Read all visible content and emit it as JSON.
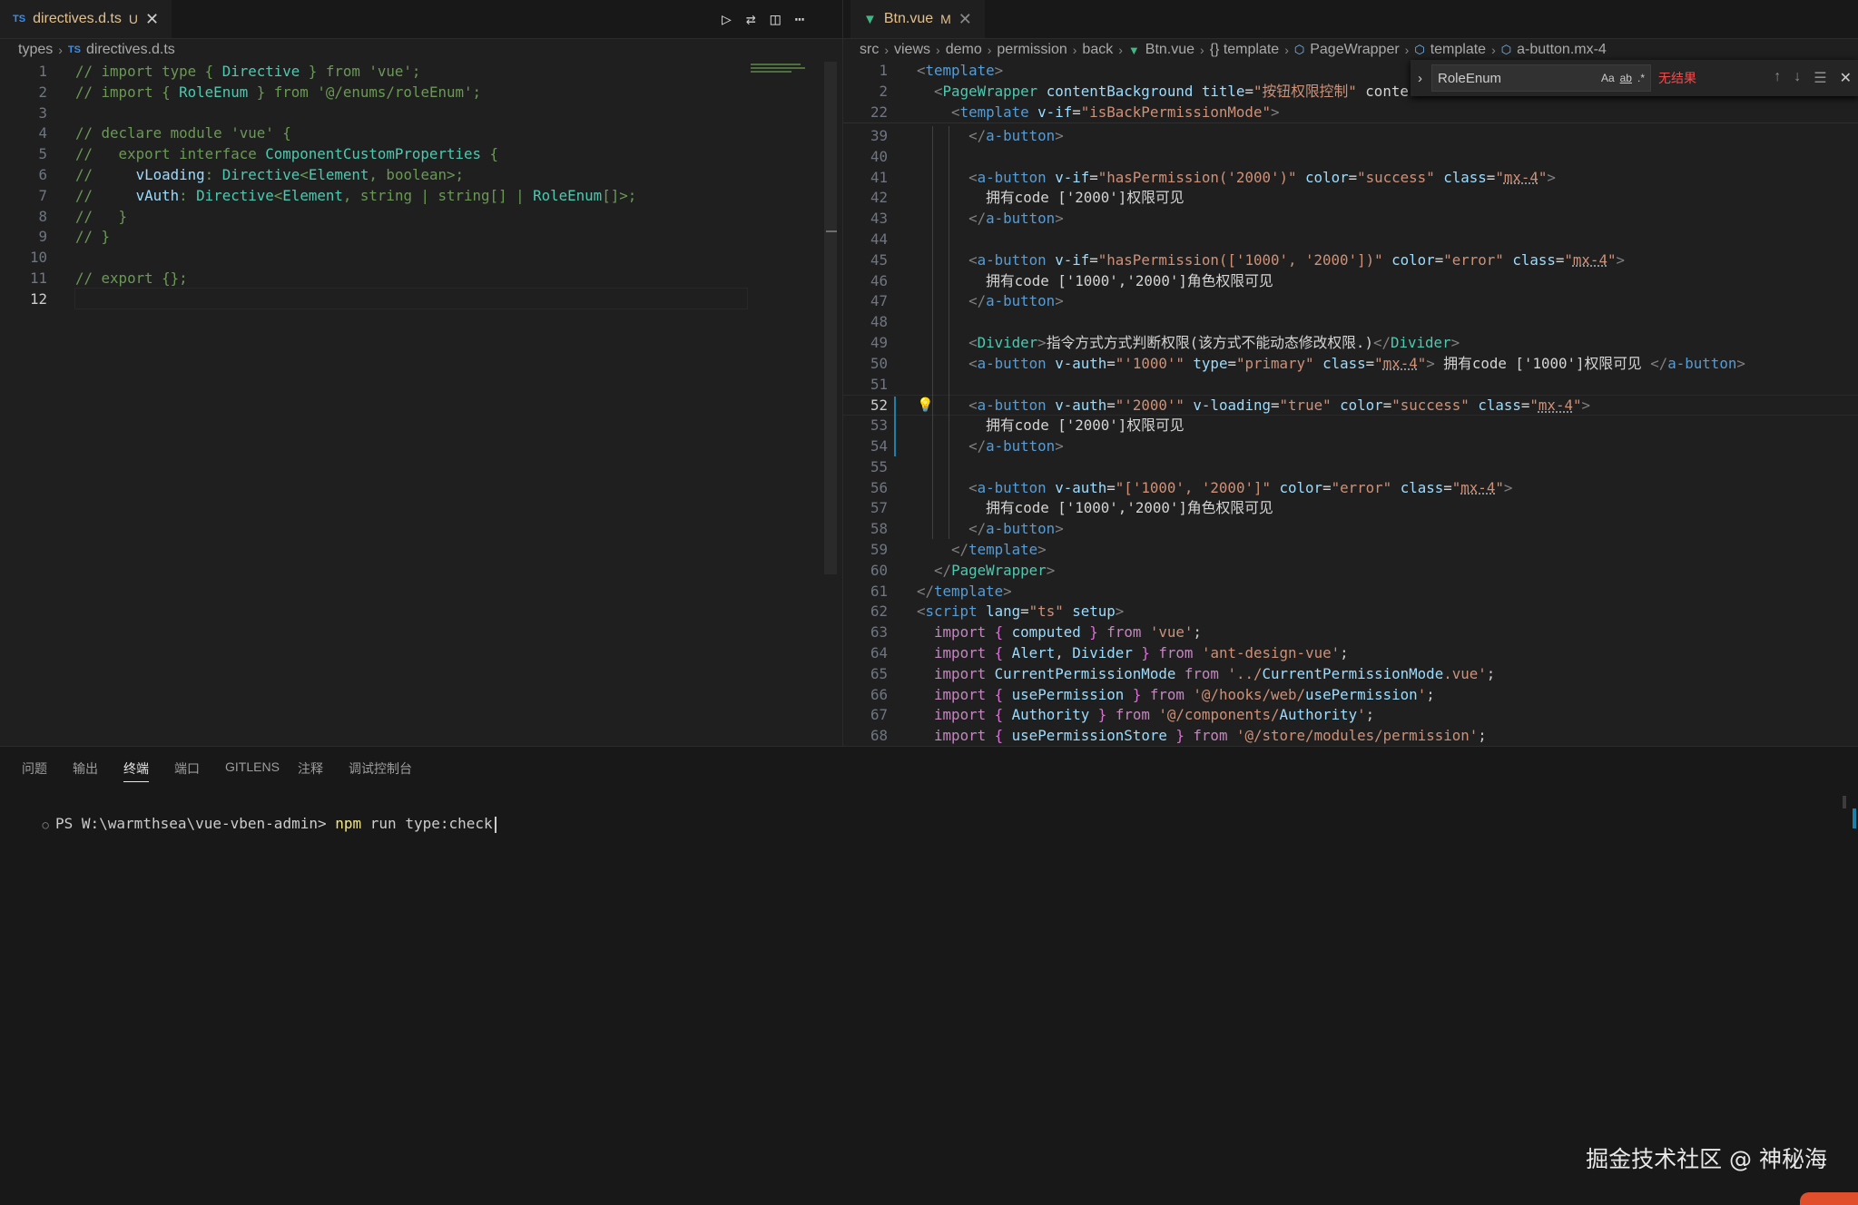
{
  "left_editor": {
    "tab": {
      "badge": "TS",
      "title": "directives.d.ts",
      "modified": "U"
    },
    "breadcrumb": {
      "folder": "types",
      "badge": "TS",
      "file": "directives.d.ts"
    },
    "lines": [
      {
        "n": "1",
        "text": "// import type { Directive } from 'vue';"
      },
      {
        "n": "2",
        "text": "// import { RoleEnum } from '@/enums/roleEnum';"
      },
      {
        "n": "3",
        "text": ""
      },
      {
        "n": "4",
        "text": "// declare module 'vue' {"
      },
      {
        "n": "5",
        "text": "//   export interface ComponentCustomProperties {"
      },
      {
        "n": "6",
        "text": "//     vLoading: Directive<Element, boolean>;"
      },
      {
        "n": "7",
        "text": "//     vAuth: Directive<Element, string | string[] | RoleEnum[]>;"
      },
      {
        "n": "8",
        "text": "//   }"
      },
      {
        "n": "9",
        "text": "// }"
      },
      {
        "n": "10",
        "text": ""
      },
      {
        "n": "11",
        "text": "// export {};"
      },
      {
        "n": "12",
        "text": ""
      }
    ]
  },
  "right_editor": {
    "tab": {
      "title": "Btn.vue",
      "modified": "M"
    },
    "breadcrumb": [
      "src",
      "views",
      "demo",
      "permission",
      "back",
      "Btn.vue",
      "{} template",
      "PageWrapper",
      "template",
      "a-button.mx-4"
    ],
    "find_widget": {
      "query": "RoleEnum",
      "opt_case": "Aa",
      "opt_word": "ab",
      "opt_regex": ".*",
      "result": "无结果"
    },
    "sticky": [
      {
        "n": "1",
        "text": "<template>"
      },
      {
        "n": "2",
        "text": "  <PageWrapper contentBackground title=\"按钮权限控制\" conte"
      },
      {
        "n": "22",
        "text": "    <template v-if=\"isBackPermissionMode\">"
      }
    ],
    "lines": [
      {
        "n": "39",
        "text": "      </a-button>"
      },
      {
        "n": "40",
        "text": ""
      },
      {
        "n": "41",
        "text": "      <a-button v-if=\"hasPermission('2000')\" color=\"success\" class=\"mx-4\">"
      },
      {
        "n": "42",
        "text": "        拥有code ['2000']权限可见"
      },
      {
        "n": "43",
        "text": "      </a-button>"
      },
      {
        "n": "44",
        "text": ""
      },
      {
        "n": "45",
        "text": "      <a-button v-if=\"hasPermission(['1000', '2000'])\" color=\"error\" class=\"mx-4\">"
      },
      {
        "n": "46",
        "text": "        拥有code ['1000','2000']角色权限可见"
      },
      {
        "n": "47",
        "text": "      </a-button>"
      },
      {
        "n": "48",
        "text": ""
      },
      {
        "n": "49",
        "text": "      <Divider>指令方式方式判断权限(该方式不能动态修改权限.)</Divider>"
      },
      {
        "n": "50",
        "text": "      <a-button v-auth=\"'1000'\" type=\"primary\" class=\"mx-4\"> 拥有code ['1000']权限可见 </a-button>"
      },
      {
        "n": "51",
        "text": ""
      },
      {
        "n": "52",
        "text": "      <a-button v-auth=\"'2000'\" v-loading=\"true\" color=\"success\" class=\"mx-4\">"
      },
      {
        "n": "53",
        "text": "        拥有code ['2000']权限可见"
      },
      {
        "n": "54",
        "text": "      </a-button>"
      },
      {
        "n": "55",
        "text": ""
      },
      {
        "n": "56",
        "text": "      <a-button v-auth=\"['1000', '2000']\" color=\"error\" class=\"mx-4\">"
      },
      {
        "n": "57",
        "text": "        拥有code ['1000','2000']角色权限可见"
      },
      {
        "n": "58",
        "text": "      </a-button>"
      },
      {
        "n": "59",
        "text": "    </template>"
      },
      {
        "n": "60",
        "text": "  </PageWrapper>"
      },
      {
        "n": "61",
        "text": "</template>"
      },
      {
        "n": "62",
        "text": "<script lang=\"ts\" setup>"
      },
      {
        "n": "63",
        "text": "  import { computed } from 'vue';"
      },
      {
        "n": "64",
        "text": "  import { Alert, Divider } from 'ant-design-vue';"
      },
      {
        "n": "65",
        "text": "  import CurrentPermissionMode from '../CurrentPermissionMode.vue';"
      },
      {
        "n": "66",
        "text": "  import { usePermission } from '@/hooks/web/usePermission';"
      },
      {
        "n": "67",
        "text": "  import { Authority } from '@/components/Authority';"
      },
      {
        "n": "68",
        "text": "  import { usePermissionStore } from '@/store/modules/permission';"
      }
    ]
  },
  "panel": {
    "tabs": [
      "问题",
      "输出",
      "终端",
      "端口",
      "GITLENS",
      "注释",
      "调试控制台"
    ],
    "active_tab": "终端",
    "terminal": {
      "prompt": "PS W:\\warmthsea\\vue-vben-admin>",
      "cmd": "npm",
      "args": " run type:check"
    }
  },
  "watermark": "掘金技术社区 @ 神秘海"
}
